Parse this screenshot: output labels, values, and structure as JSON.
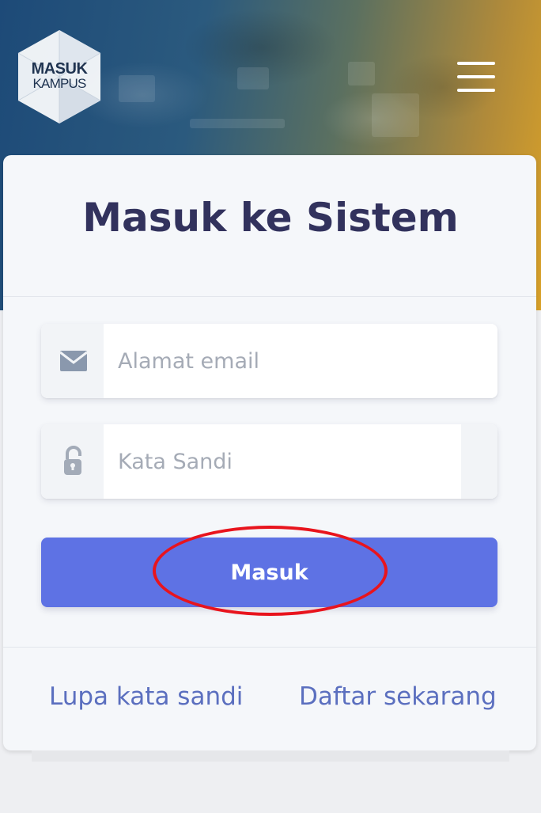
{
  "header": {
    "logo_line1": "MASUK",
    "logo_line2": "KAMPUS"
  },
  "login": {
    "title": "Masuk ke Sistem",
    "email_placeholder": "Alamat email",
    "email_value": "",
    "password_placeholder": "Kata Sandi",
    "password_value": "",
    "submit_label": "Masuk",
    "forgot_label": "Lupa kata sandi",
    "register_label": "Daftar sekarang"
  },
  "colors": {
    "primary": "#5e72e4",
    "title": "#32325d",
    "link": "#5b6fbf",
    "annotation": "#e8141d"
  },
  "icons": {
    "email": "envelope-icon",
    "password": "unlock-icon",
    "menu": "hamburger-menu-icon"
  }
}
